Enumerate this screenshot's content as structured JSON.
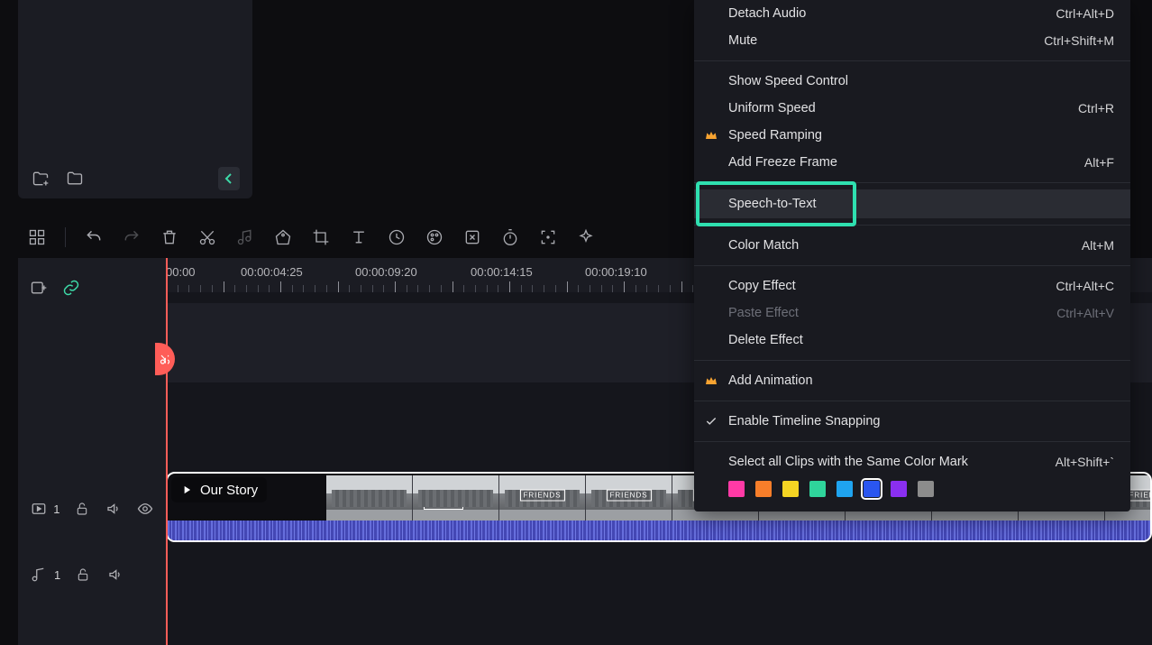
{
  "ruler": {
    "labels": [
      "00:00",
      "00:00:04:25",
      "00:00:09:20",
      "00:00:14:15",
      "00:00:19:10"
    ]
  },
  "clip": {
    "title": "Our Story"
  },
  "track": {
    "video_count": "1",
    "audio_count": "1"
  },
  "menu": {
    "detach_audio": {
      "label": "Detach Audio",
      "kbd": "Ctrl+Alt+D"
    },
    "mute": {
      "label": "Mute",
      "kbd": "Ctrl+Shift+M"
    },
    "show_speed": {
      "label": "Show Speed Control"
    },
    "uniform_speed": {
      "label": "Uniform Speed",
      "kbd": "Ctrl+R"
    },
    "speed_ramping": {
      "label": "Speed Ramping"
    },
    "freeze_frame": {
      "label": "Add Freeze Frame",
      "kbd": "Alt+F"
    },
    "speech_to_text": {
      "label": "Speech-to-Text"
    },
    "color_match": {
      "label": "Color Match",
      "kbd": "Alt+M"
    },
    "copy_effect": {
      "label": "Copy Effect",
      "kbd": "Ctrl+Alt+C"
    },
    "paste_effect": {
      "label": "Paste Effect",
      "kbd": "Ctrl+Alt+V"
    },
    "delete_effect": {
      "label": "Delete Effect"
    },
    "add_animation": {
      "label": "Add Animation"
    },
    "snapping": {
      "label": "Enable Timeline Snapping"
    },
    "select_same_color": {
      "label": "Select all Clips with the Same Color Mark",
      "kbd": "Alt+Shift+`"
    }
  },
  "colors": [
    "#ff3aa6",
    "#f77e2a",
    "#f4d423",
    "#2fd49b",
    "#1fa4f0",
    "#2a56f0",
    "#8a2ff0",
    "#8c8c8c"
  ]
}
